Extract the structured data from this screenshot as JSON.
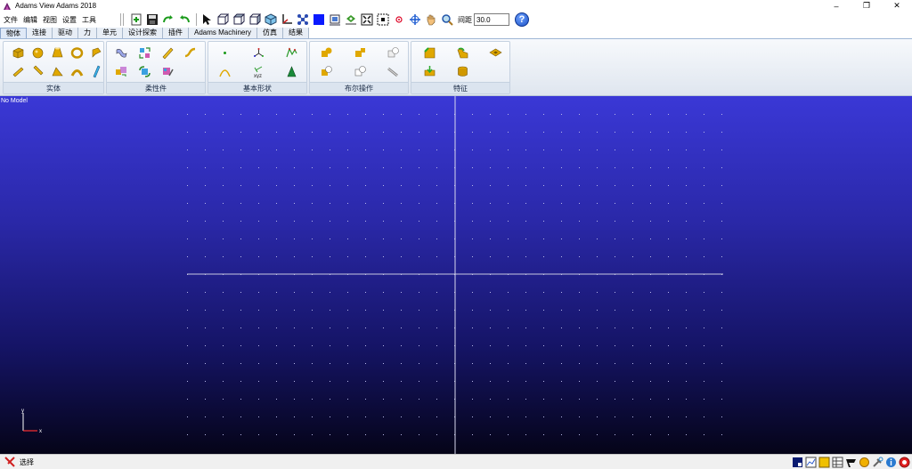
{
  "window": {
    "title": "Adams View Adams 2018",
    "minimize_glyph": "–",
    "restore_glyph": "❐",
    "close_glyph": "✕"
  },
  "menu": [
    "文件",
    "编辑",
    "视图",
    "设置",
    "工具"
  ],
  "toolbar": {
    "icons": [
      "new-model-icon",
      "save-icon",
      "redo-icon",
      "undo-icon",
      "select-arrow-icon",
      "front-view-icon",
      "top-view-icon",
      "side-view-icon",
      "iso-view-icon",
      "coordinate-axis-icon",
      "grid-network-icon",
      "render-mode-icon",
      "camera-icon",
      "fit-view-icon",
      "zoom-box-icon",
      "center-icon",
      "rotate-icon",
      "pan-hand-icon",
      "zoom-icon"
    ],
    "spacing_label": "间距",
    "spacing_value": "30.0",
    "help_glyph": "?"
  },
  "tabs": [
    "物体",
    "连接",
    "驱动",
    "力",
    "单元",
    "设计探索",
    "插件",
    "Adams Machinery",
    "仿真",
    "结果"
  ],
  "active_tab": 0,
  "ribbon_groups": [
    {
      "label": "实体",
      "icons": [
        "box-icon",
        "link-icon",
        "sphere-icon",
        "frustum-icon",
        "torus-icon",
        "cylinder-icon",
        "extrusion-icon",
        "revolution-icon",
        "plate-icon",
        "plane-icon"
      ]
    },
    {
      "label": "柔性件",
      "icons": [
        "flex-body-icon",
        "flex-body-replace-icon",
        "discrete-flex-link-icon",
        "flex-beam-icon",
        "flex-swap-icon",
        "flex-convert-icon",
        "flex-material-icon"
      ]
    },
    {
      "label": "基本形状",
      "icons": [
        "marker-point-icon",
        "arc-icon",
        "construction-frame-icon",
        "xyz-marker-icon",
        "polyline-icon",
        "cone-marker-icon"
      ]
    },
    {
      "label": "布尔操作",
      "icons": [
        "boolean-union-icon",
        "boolean-intersect-icon",
        "boolean-merge-icon",
        "boolean-cut-icon",
        "boolean-split-icon",
        "boolean-chain-icon"
      ]
    },
    {
      "label": "特征",
      "icons": [
        "chamfer-icon",
        "hole-icon",
        "fillet-icon",
        "boss-icon",
        "hollow-icon"
      ]
    }
  ],
  "viewport": {
    "status": "No Model",
    "background_top": "#3a38d6",
    "background_bottom": "#050418",
    "axis_y": "y",
    "axis_x": "x"
  },
  "statusbar": {
    "text": "选择",
    "tools": [
      "model-browser-icon",
      "plot-icon",
      "color-icon",
      "table-icon",
      "pointer-flag-icon",
      "sun-light-icon",
      "tools-icon",
      "info-icon",
      "stop-icon"
    ]
  }
}
